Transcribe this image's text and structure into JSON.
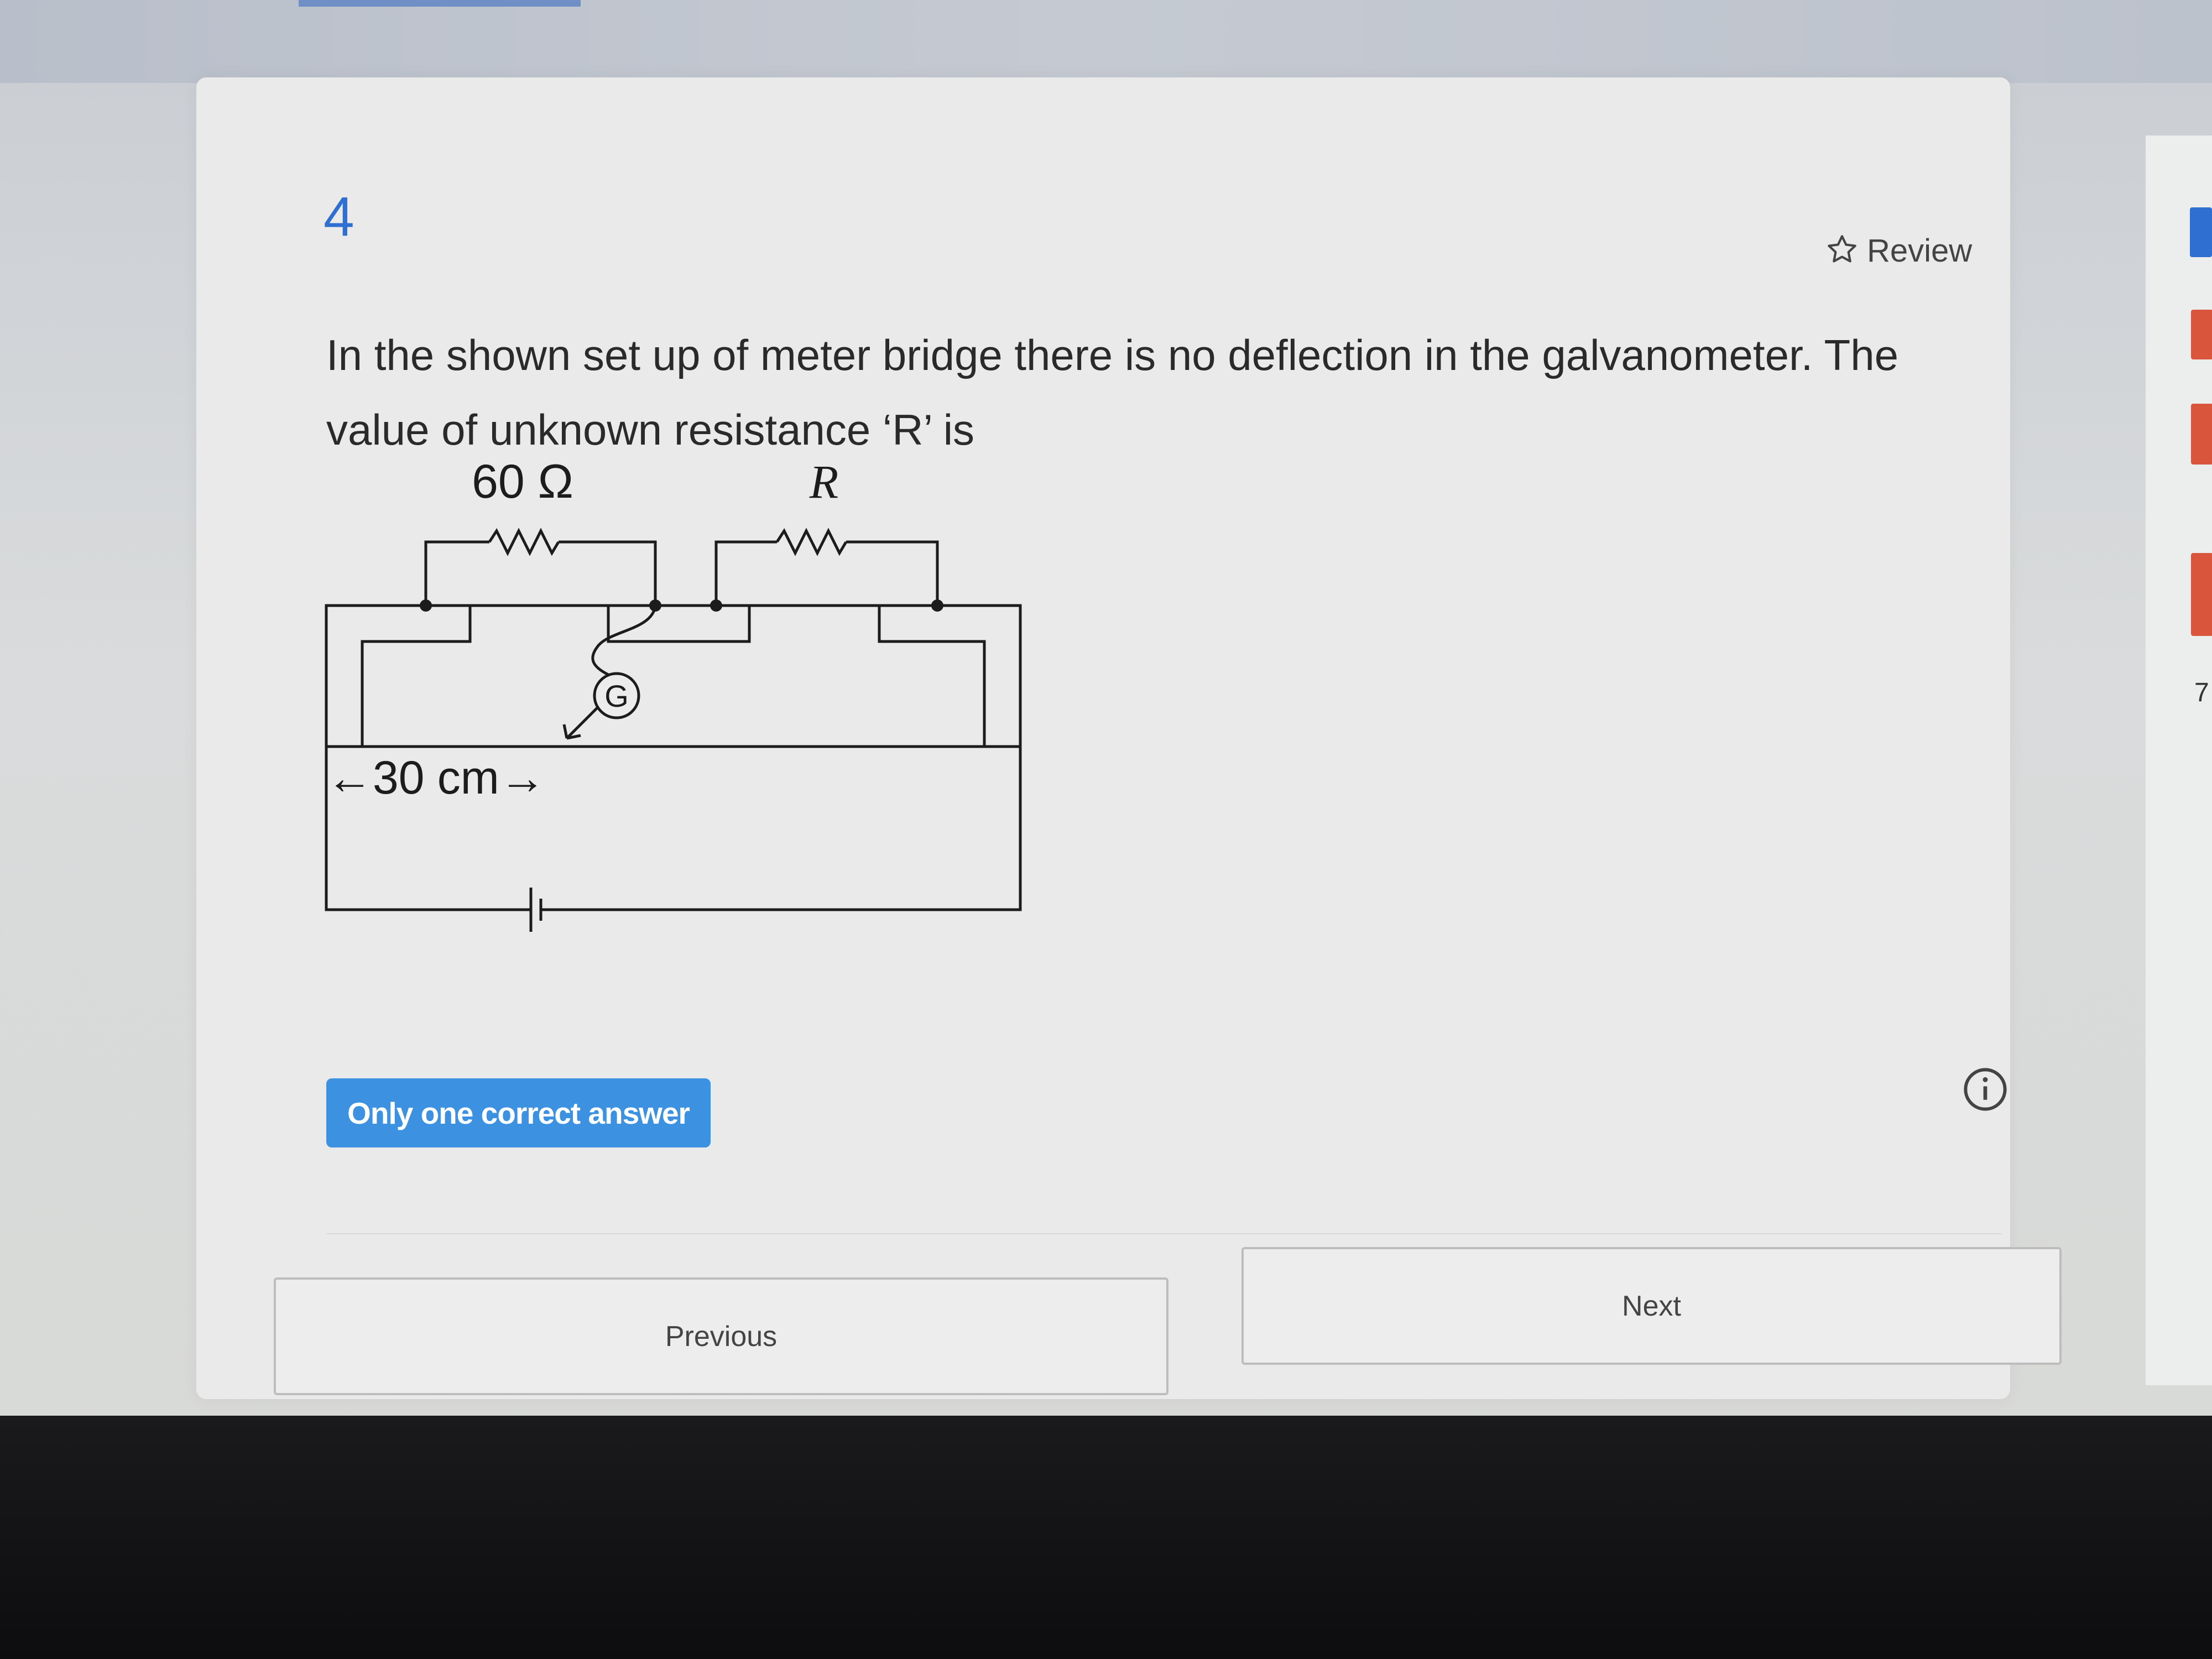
{
  "question": {
    "number": "4",
    "review_label": "Review",
    "text": "In the shown set up of meter bridge there is no deflection in the galvanometer. The value of unknown resistance ‘R’ is",
    "answer_type_badge": "Only one correct answer"
  },
  "diagram": {
    "left_resistor_label": "60 Ω",
    "right_resistor_label": "R",
    "galvanometer_label": "G",
    "length_label": "←30 cm→"
  },
  "navigation": {
    "previous_label": "Previous",
    "next_label": "Next"
  },
  "side_panel": {
    "partial_number": "7"
  },
  "colors": {
    "accent": "#2f6fd1",
    "badge": "#3c92e0",
    "flag": "#d9553b"
  }
}
